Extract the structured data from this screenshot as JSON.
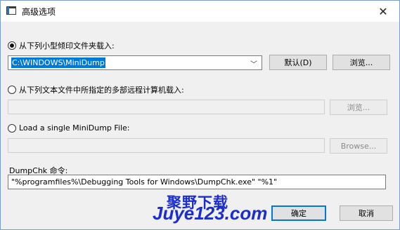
{
  "window": {
    "title": "高级选项",
    "close_glyph": "✕"
  },
  "option_folder": {
    "label": "从下列小型倾印文件夹载入:",
    "selected": true,
    "path_value": "C:\\WINDOWS\\MiniDump",
    "default_button": "默认(D)",
    "browse_button": "浏览..."
  },
  "option_remote": {
    "label": "从下列文本文件中所指定的多部远程计算机载入:",
    "selected": false,
    "path_value": "",
    "browse_button": "浏览..."
  },
  "option_single": {
    "label": "Load a single MiniDump File:",
    "selected": false,
    "path_value": "",
    "browse_button": "Browse..."
  },
  "command": {
    "label": "DumpChk 命令:",
    "value": "\"%programfiles%\\Debugging Tools for Windows\\DumpChk.exe\" \"%1\""
  },
  "footer": {
    "ok_button": "确定",
    "cancel_button": "取消"
  },
  "watermark": {
    "line1": "聚野下载",
    "line2": "Juye123.com"
  },
  "colors": {
    "selection": "#0078d7",
    "watermark": "#1a2ecf"
  }
}
